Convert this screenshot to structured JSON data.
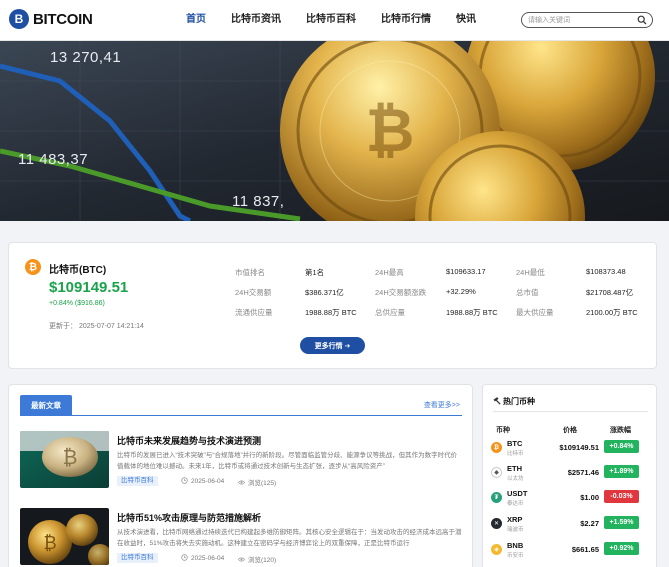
{
  "header": {
    "logo_badge": "B",
    "logo_text": "BITCOIN",
    "nav": [
      "首页",
      "比特币资讯",
      "比特币百科",
      "比特币行情",
      "快讯"
    ],
    "search_placeholder": "请输入关键词"
  },
  "hero": {
    "numbers": [
      "13 270,41",
      "11 483,37",
      "11 837,"
    ]
  },
  "price_card": {
    "coin_badge": "₿",
    "coin_name": "比特币(BTC)",
    "price": "$109149.51",
    "change": "+0.84% ($916.86)",
    "updated": "更新于： 2025-07-07 14:21:14",
    "stats": [
      {
        "label": "市值排名",
        "value": "第1名"
      },
      {
        "label": "24H最高",
        "value": "$109633.17"
      },
      {
        "label": "24H最低",
        "value": "$108373.48"
      },
      {
        "label": "24H交易额",
        "value": "$386.371亿"
      },
      {
        "label": "24H交易额涨跌",
        "value": "+32.29%"
      },
      {
        "label": "总市值",
        "value": "$21708.487亿"
      },
      {
        "label": "流通供应量",
        "value": "1988.88万 BTC"
      },
      {
        "label": "总供应量",
        "value": "1988.88万 BTC"
      },
      {
        "label": "最大供应量",
        "value": "2100.00万 BTC"
      }
    ],
    "more_button": "更多行情 ➔"
  },
  "articles": {
    "tab": "最新文章",
    "view_more": "查看更多>>",
    "items": [
      {
        "title": "比特币未来发展趋势与技术演进预测",
        "summary": "比特币的发展已进入“技术突破”与“合规落地”并行的新阶段。尽管面临监管分歧、能源争议等挑战，但其作为数字时代价值载体的地位难以撼动。未来1年，比特币或将通过技术创新与生态扩张，逐步从“高风险资产”",
        "tag": "比特币百科",
        "date": "2025-06-04",
        "views": "浏览(125)"
      },
      {
        "title": "比特币51%攻击原理与防范措施解析",
        "summary": "从技术演进看，比特币网络通过持续迭代已构建起多维防御矩阵。其核心安全逻辑在于：当发动攻击的经济成本远高于潜在收益时，51%攻击将失去实施动机。这种建立在密码学与经济博弈论上的双重保障，正是比特币运行",
        "tag": "比特币百科",
        "date": "2025-06-04",
        "views": "浏览(120)"
      }
    ]
  },
  "hot_coins": {
    "title": "热门币种",
    "headers": [
      "币种",
      "价格",
      "涨跌幅"
    ],
    "rows": [
      {
        "symbol": "BTC",
        "name": "比特币",
        "price": "$109149.51",
        "change": "+0.84%",
        "dir": "up",
        "color": "#f7931a",
        "glyph": "₿"
      },
      {
        "symbol": "ETH",
        "name": "以太坊",
        "price": "$2571.46",
        "change": "+1.89%",
        "dir": "up",
        "color": "#ffffff",
        "glyph": "◆"
      },
      {
        "symbol": "USDT",
        "name": "泰达币",
        "price": "$1.00",
        "change": "-0.03%",
        "dir": "down",
        "color": "#26a17b",
        "glyph": "₮"
      },
      {
        "symbol": "XRP",
        "name": "瑞波币",
        "price": "$2.27",
        "change": "+1.59%",
        "dir": "up",
        "color": "#23292f",
        "glyph": "✕"
      },
      {
        "symbol": "BNB",
        "name": "币安币",
        "price": "$661.65",
        "change": "+0.92%",
        "dir": "up",
        "color": "#f3ba2f",
        "glyph": "◈"
      }
    ]
  }
}
